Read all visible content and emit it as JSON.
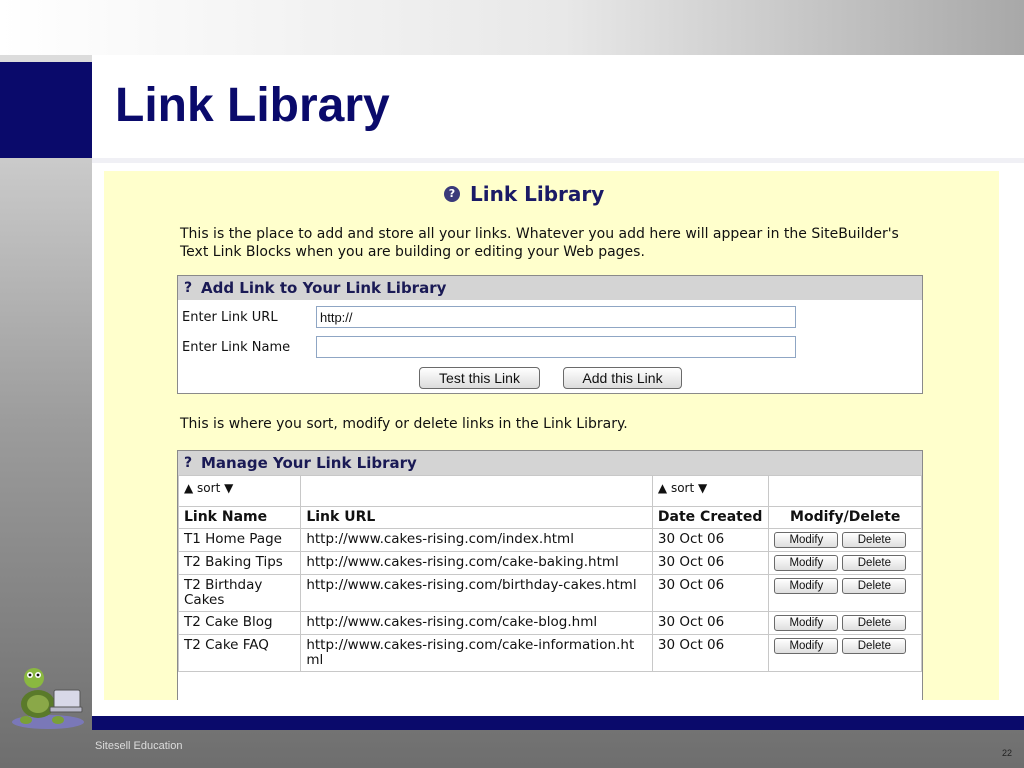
{
  "slide": {
    "title": "Link Library",
    "footer_left": "Sitesell Education",
    "page_number": "22",
    "navy_color": "#0a0a6b"
  },
  "screenshot": {
    "title": "Link Library",
    "help_icon": "question-icon",
    "intro": "This is the place to add and store all your links. Whatever you add here will appear in the SiteBuilder's Text Link Blocks when you are building or editing your Web pages.",
    "add_panel": {
      "heading": "Add Link to Your Link Library",
      "url_label": "Enter Link URL",
      "url_value": "http://",
      "name_label": "Enter Link Name",
      "name_value": "",
      "test_button": "Test this Link",
      "add_button": "Add this Link"
    },
    "sort_note": "This is where you sort, modify or delete links in the Link Library.",
    "manage_panel": {
      "heading": "Manage Your Link Library",
      "sort_label": "▲ sort ▼",
      "columns": [
        "Link Name",
        "Link URL",
        "Date Created",
        "Modify/Delete"
      ],
      "modify_label": "Modify",
      "delete_label": "Delete",
      "rows": [
        {
          "name": "T1 Home Page",
          "url": "http://www.cakes-rising.com/index.html",
          "date": "30 Oct 06"
        },
        {
          "name": "T2 Baking Tips",
          "url": "http://www.cakes-rising.com/cake-baking.html",
          "date": "30 Oct 06"
        },
        {
          "name": "T2 Birthday Cakes",
          "url": "http://www.cakes-rising.com/birthday-cakes.html",
          "date": "30 Oct 06"
        },
        {
          "name": "T2 Cake Blog",
          "url": "http://www.cakes-rising.com/cake-blog.hml",
          "date": "30 Oct 06"
        },
        {
          "name": "T2 Cake FAQ",
          "url": "http://www.cakes-rising.com/cake-information.html",
          "date": "30 Oct 06"
        }
      ]
    }
  }
}
